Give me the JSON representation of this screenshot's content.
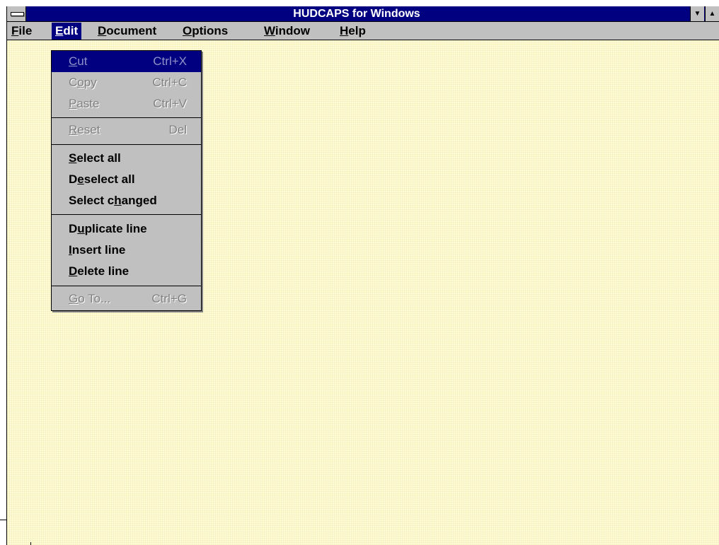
{
  "window": {
    "title": "HUDCAPS for Windows",
    "minimize_glyph": "▼",
    "maximize_glyph": "▲"
  },
  "menubar": {
    "items": [
      {
        "hotkey": "F",
        "rest": "ile"
      },
      {
        "hotkey": "E",
        "rest": "dit"
      },
      {
        "hotkey": "D",
        "rest": "ocument"
      },
      {
        "hotkey": "O",
        "rest": "ptions"
      },
      {
        "hotkey": "W",
        "rest": "indow"
      },
      {
        "hotkey": "H",
        "rest": "elp"
      }
    ]
  },
  "edit_menu": {
    "cut": {
      "pre": "",
      "hotkey": "C",
      "post": "ut",
      "accel": "Ctrl+X"
    },
    "copy": {
      "pre": "C",
      "hotkey": "o",
      "post": "py",
      "accel": "Ctrl+C"
    },
    "paste": {
      "pre": "",
      "hotkey": "P",
      "post": "aste",
      "accel": "Ctrl+V"
    },
    "reset": {
      "pre": "",
      "hotkey": "R",
      "post": "eset",
      "accel": "Del"
    },
    "select_all": {
      "pre": "",
      "hotkey": "S",
      "post": "elect all"
    },
    "deselect_all": {
      "pre": "D",
      "hotkey": "e",
      "post": "select all"
    },
    "select_changed": {
      "pre": "Select c",
      "hotkey": "h",
      "post": "anged"
    },
    "duplicate_line": {
      "pre": "D",
      "hotkey": "u",
      "post": "plicate line"
    },
    "insert_line": {
      "pre": "",
      "hotkey": "I",
      "post": "nsert line"
    },
    "delete_line": {
      "pre": "",
      "hotkey": "D",
      "post": "elete line"
    },
    "go_to": {
      "pre": "",
      "hotkey": "G",
      "post": "o To...",
      "accel": "Ctrl+G"
    }
  },
  "colors": {
    "title_bar": "#000080",
    "menu_face": "#c0c0c0",
    "client_background": "#fffbd6",
    "highlight": "#000080"
  }
}
